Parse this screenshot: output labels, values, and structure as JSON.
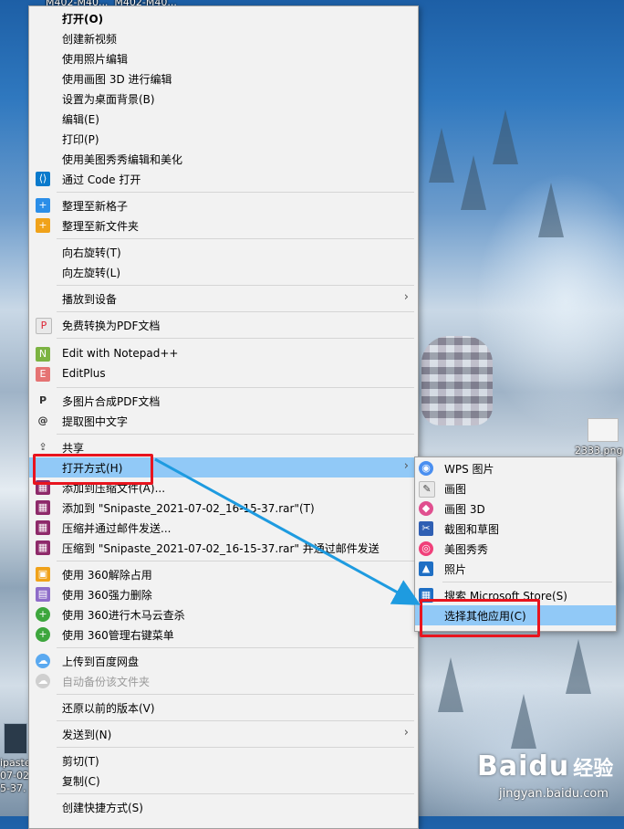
{
  "desktop": {
    "top_labels": "M402-M40...  M402-M40...",
    "left_file_label": "ipaste\n07-02\n5-37.",
    "right_file_label": "2333.png",
    "watermark_main": "Baidu",
    "watermark_cn": "经验",
    "watermark_url": "jingyan.baidu.com"
  },
  "menu": {
    "items": [
      {
        "label": "打开(O)",
        "icon": "none"
      },
      {
        "label": "创建新视频",
        "icon": "none"
      },
      {
        "label": "使用照片编辑",
        "icon": "none"
      },
      {
        "label": "使用画图 3D 进行编辑",
        "icon": "none"
      },
      {
        "label": "设置为桌面背景(B)",
        "icon": "none"
      },
      {
        "label": "编辑(E)",
        "icon": "none"
      },
      {
        "label": "打印(P)",
        "icon": "none"
      },
      {
        "label": "使用美图秀秀编辑和美化",
        "icon": "none"
      },
      {
        "label": "通过 Code 打开",
        "icon": "vscode-icon"
      },
      {
        "label": "整理至新格子",
        "icon": "plus-blue-icon"
      },
      {
        "label": "整理至新文件夹",
        "icon": "plus-orange-icon"
      },
      {
        "label": "向右旋转(T)",
        "icon": "none"
      },
      {
        "label": "向左旋转(L)",
        "icon": "none"
      },
      {
        "label": "播放到设备",
        "icon": "none"
      },
      {
        "label": "免费转换为PDF文档",
        "icon": "pdf-icon"
      },
      {
        "label": "Edit with Notepad++",
        "icon": "notepadpp-icon"
      },
      {
        "label": "EditPlus",
        "icon": "editplus-icon"
      },
      {
        "label": "多图片合成PDF文档",
        "icon": "pdf-merge-icon"
      },
      {
        "label": "提取图中文字",
        "icon": "ocr-icon"
      },
      {
        "label": "共享",
        "icon": "share-icon"
      },
      {
        "label": "打开方式(H)",
        "icon": "none"
      },
      {
        "label": "添加到压缩文件(A)...",
        "icon": "winrar-icon"
      },
      {
        "label": "添加到 \"Snipaste_2021-07-02_16-15-37.rar\"(T)",
        "icon": "winrar-icon"
      },
      {
        "label": "压缩并通过邮件发送...",
        "icon": "winrar-icon"
      },
      {
        "label": "压缩到 \"Snipaste_2021-07-02_16-15-37.rar\" 并通过邮件发送",
        "icon": "winrar-icon"
      },
      {
        "label": "使用 360解除占用",
        "icon": "unlock-360-icon"
      },
      {
        "label": "使用 360强力删除",
        "icon": "delete-360-icon"
      },
      {
        "label": "使用 360进行木马云查杀",
        "icon": "scan-360-icon"
      },
      {
        "label": "使用 360管理右键菜单",
        "icon": "manage-360-icon"
      },
      {
        "label": "上传到百度网盘",
        "icon": "baidu-netdisk-icon"
      },
      {
        "label": "自动备份该文件夹",
        "icon": "baidu-backup-icon"
      },
      {
        "label": "还原以前的版本(V)",
        "icon": "none"
      },
      {
        "label": "发送到(N)",
        "icon": "none"
      },
      {
        "label": "剪切(T)",
        "icon": "none"
      },
      {
        "label": "复制(C)",
        "icon": "none"
      },
      {
        "label": "创建快捷方式(S)",
        "icon": "none"
      }
    ],
    "submenu_arrow": "›"
  },
  "submenu": {
    "items": [
      {
        "label": "WPS 图片",
        "icon": "wps-photo-icon"
      },
      {
        "label": "画图",
        "icon": "paint-icon"
      },
      {
        "label": "画图 3D",
        "icon": "paint3d-icon"
      },
      {
        "label": "截图和草图",
        "icon": "snip-sketch-icon"
      },
      {
        "label": "美图秀秀",
        "icon": "meitu-icon"
      },
      {
        "label": "照片",
        "icon": "photos-icon"
      },
      {
        "label": "搜索 Microsoft Store(S)",
        "icon": "store-icon"
      },
      {
        "label": "选择其他应用(C)",
        "icon": "none"
      }
    ]
  },
  "colors": {
    "highlight": "#91c9f7",
    "annotation": "#e8141e",
    "arrow": "#1e9be0"
  }
}
